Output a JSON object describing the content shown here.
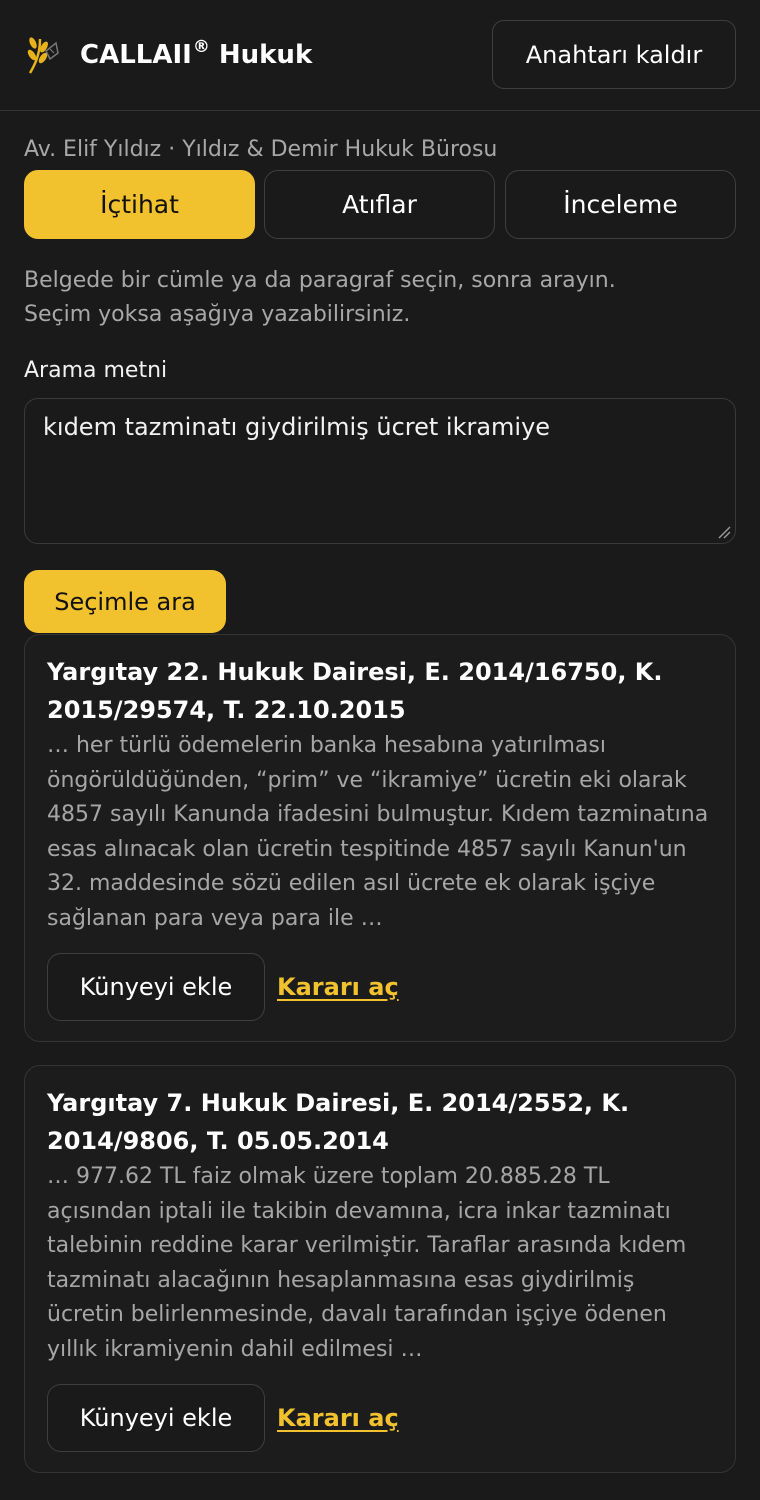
{
  "header": {
    "brand_name": "CALLAII",
    "brand_mark": "®",
    "brand_suffix": "Hukuk",
    "logo_icon": "wheat-sprig-icon",
    "remove_key_label": "Anahtarı kaldır"
  },
  "user": {
    "line": "Av. Elif Yıldız · Yıldız & Demir Hukuk Bürosu"
  },
  "tabs": [
    {
      "label": "İçtihat",
      "active": true
    },
    {
      "label": "Atıflar",
      "active": false
    },
    {
      "label": "İnceleme",
      "active": false
    }
  ],
  "instructions": {
    "line1": "Belgede bir cümle ya da paragraf seçin, sonra arayın.",
    "line2": "Seçim yoksa aşağıya yazabilirsiniz."
  },
  "search": {
    "label": "Arama metni",
    "value": "kıdem tazminatı giydirilmiş ücret ikramiye",
    "button_label": "Seçimle ara"
  },
  "results": [
    {
      "title": "Yargıtay 22. Hukuk Dairesi, E. 2014/16750, K. 2015/29574, T. 22.10.2015",
      "snippet": "… her türlü ödemelerin banka hesabına yatırılması öngörüldüğünden, “prim” ve “ikramiye” ücretin eki olarak 4857 sayılı Kanunda ifadesini bulmuştur. Kıdem tazminatına esas alınacak olan ücretin tespitinde 4857 sayılı Kanun'un 32. maddesinde sözü edilen asıl ücrete ek olarak işçiye sağlanan para veya para ile …",
      "add_label": "Künyeyi ekle",
      "open_label": "Kararı aç"
    },
    {
      "title": "Yargıtay 7. Hukuk Dairesi, E. 2014/2552, K. 2014/9806, T. 05.05.2014",
      "snippet": "… 977.62 TL faiz olmak üzere toplam 20.885.28 TL açısından iptali ile takibin devamına, icra inkar tazminatı talebinin reddine karar verilmiştir. Taraflar arasında kıdem tazminatı alacağının hesaplanmasına esas giydirilmiş ücretin belirlenmesinde, davalı tarafından işçiye ödenen yıllık ikramiyenin dahil edilmesi …",
      "add_label": "Künyeyi ekle",
      "open_label": "Kararı aç"
    }
  ],
  "colors": {
    "accent": "#f2c12e",
    "background": "#1a1a1a",
    "muted_text": "#a8a8a8"
  }
}
